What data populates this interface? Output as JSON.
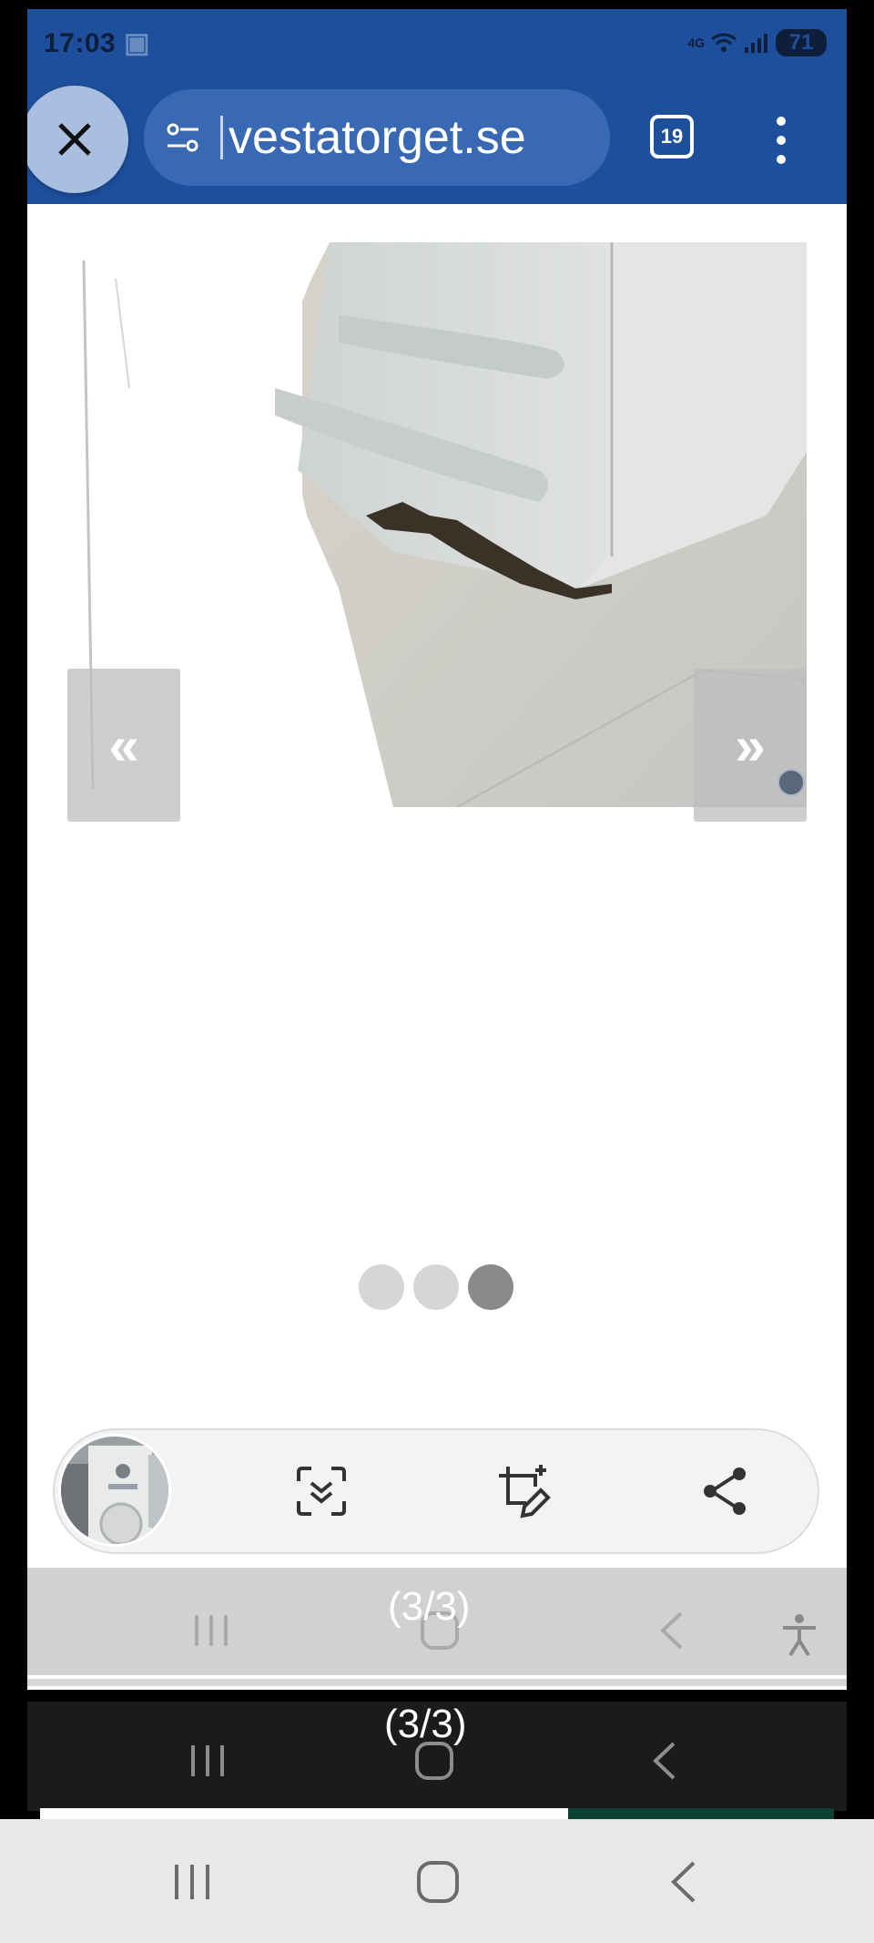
{
  "status_bar": {
    "time": "17:03",
    "network": "4G",
    "battery": "71"
  },
  "browser": {
    "url": "vestatorget.se",
    "tab_count": "19",
    "icons": {
      "close": "close-icon",
      "site_settings": "tune-icon",
      "menu": "more-vert-icon"
    },
    "colors": {
      "toolbar": "#1d4f9c",
      "url_pill": "#3a69b3"
    }
  },
  "gallery": {
    "prev_label": "«",
    "next_label": "»",
    "pagination": {
      "total": 3,
      "active_index": 2
    }
  },
  "action_bar": {
    "icons": [
      "scan-icon",
      "crop-edit-icon",
      "share-icon"
    ]
  },
  "overlay": {
    "counter_top": "(3/3)",
    "counter_bottom": "(3/3)"
  },
  "system_nav": {
    "icons": [
      "recents-icon",
      "home-icon",
      "back-icon"
    ]
  }
}
